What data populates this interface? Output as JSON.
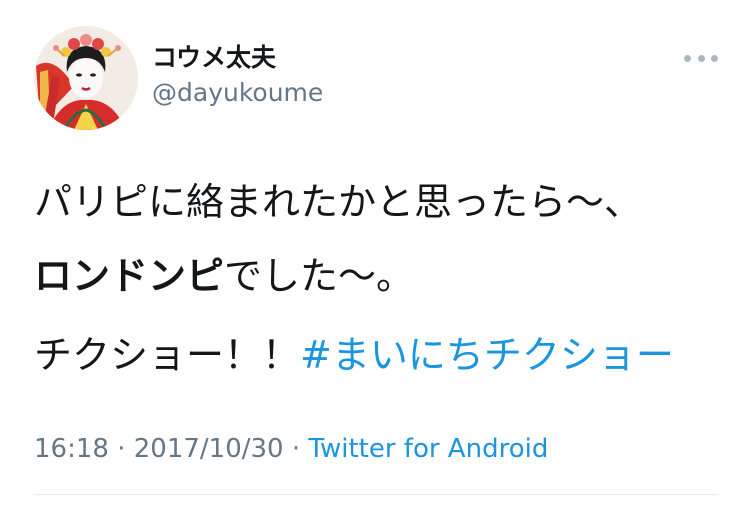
{
  "author": {
    "display_name": "コウメ太夫",
    "handle": "@dayukoume"
  },
  "tweet": {
    "line1": "パリピに絡まれたかと思ったら〜、",
    "line2_bold": "ロンドンピ",
    "line2_rest": "でした〜。",
    "line3_text": "チクショー！！",
    "hashtag": "#まいにちチクショー"
  },
  "meta": {
    "time": "16:18",
    "sep1": " · ",
    "date": "2017/10/30",
    "sep2": " · ",
    "source": "Twitter for Android"
  },
  "colors": {
    "link": "#1b95e0",
    "secondary": "#657786",
    "text": "#14171a"
  },
  "icons": {
    "more": "more-dots-icon",
    "avatar": "avatar-image"
  }
}
